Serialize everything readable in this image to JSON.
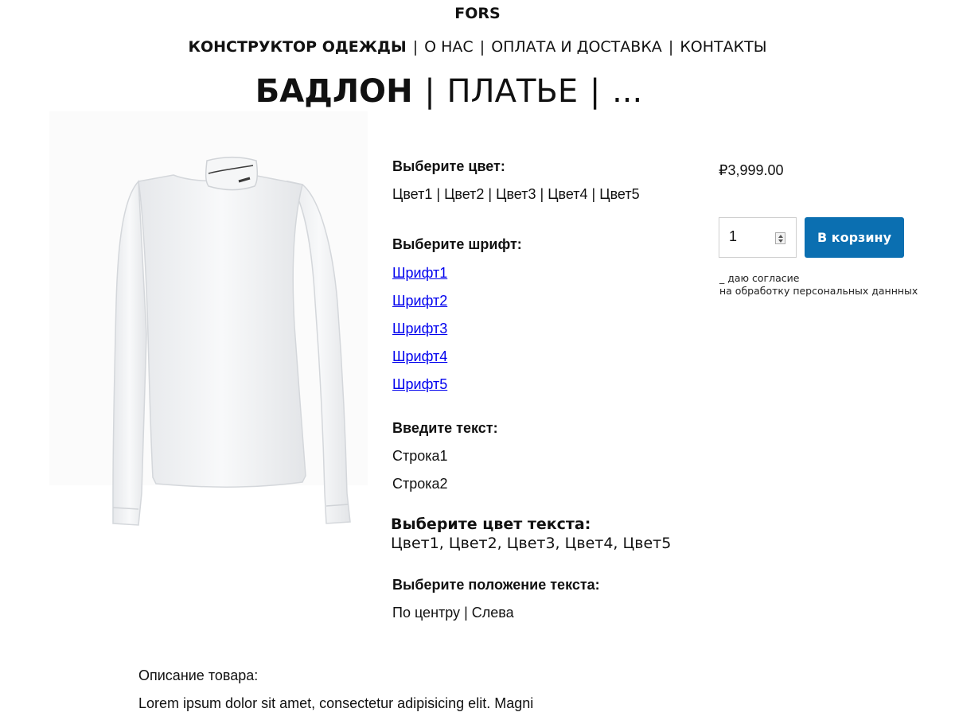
{
  "brand": "FORS",
  "main_nav": [
    {
      "label": "КОНСТРУКТОР ОДЕЖДЫ",
      "active": true
    },
    {
      "label": "О НАС"
    },
    {
      "label": "ОПЛАТА И ДОСТАВКА"
    },
    {
      "label": "КОНТАКТЫ"
    }
  ],
  "separator": "|",
  "product_nav": [
    {
      "label": "БАДЛОН",
      "active": true
    },
    {
      "label": "ПЛАТЬЕ"
    },
    {
      "label": "..."
    }
  ],
  "options": {
    "color": {
      "heading": "Выберите цвет:",
      "items": [
        "Цвет1",
        "Цвет2",
        "Цвет3",
        "Цвет4",
        "Цвет5"
      ]
    },
    "font": {
      "heading": "Выберите шрифт:",
      "items": [
        "Шрифт1",
        "Шрифт2",
        "Шрифт3",
        "Шрифт4",
        "Шрифт5"
      ]
    },
    "text": {
      "heading": "Введите текст:",
      "items": [
        "Строка1",
        "Строка2"
      ]
    },
    "text_color": {
      "heading": "Выберите цвет текста:",
      "line": "Цвет1, Цвет2, Цвет3, Цвет4, Цвет5"
    },
    "position": {
      "heading": "Выберите положение текста:",
      "items": [
        "По центру",
        "Слева"
      ]
    }
  },
  "purchase": {
    "price": "₽3,999.00",
    "quantity": "1",
    "add_to_cart": "В корзину",
    "consent_line1": "_ даю согласие",
    "consent_line2": "на обработку персональных даннных"
  },
  "description": {
    "heading": "Описание товара:",
    "text": "Lorem ipsum dolor sit amet, consectetur adipisicing elit. Magni"
  },
  "colors": {
    "button": "#0b6fb1",
    "text": "#111111",
    "background": "#ffffff"
  },
  "image": {
    "icon": "white-turtleneck-product-photo"
  }
}
